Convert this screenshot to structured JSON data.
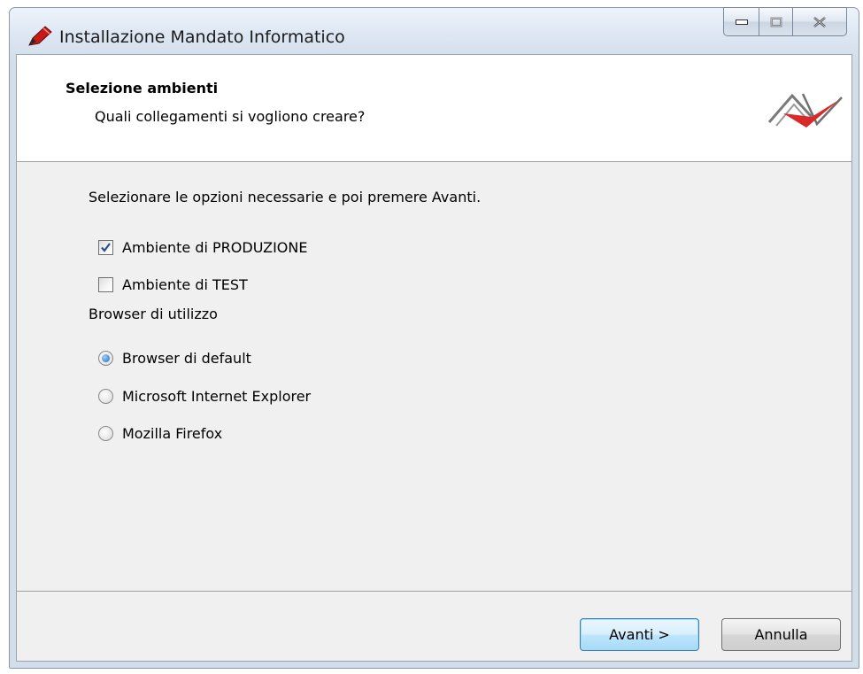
{
  "window": {
    "title": "Installazione Mandato Informatico",
    "controls": {
      "minimize_icon": "minimize-icon",
      "maximize_icon": "maximize-icon",
      "close_icon": "close-icon"
    }
  },
  "header": {
    "title": "Selezione ambienti",
    "subtitle": "Quali collegamenti si vogliono creare?",
    "logo_icon": "checkmark-logo",
    "logo_color": "#d92a2a"
  },
  "body": {
    "instruction": "Selezionare le opzioni necessarie e poi premere Avanti.",
    "environments": [
      {
        "label": "Ambiente di PRODUZIONE",
        "checked": true
      },
      {
        "label": "Ambiente di TEST",
        "checked": false
      }
    ],
    "browser_section_label": "Browser di utilizzo",
    "browsers": [
      {
        "label": "Browser di default",
        "selected": true
      },
      {
        "label": "Microsoft Internet Explorer",
        "selected": false
      },
      {
        "label": "Mozilla Firefox",
        "selected": false
      }
    ]
  },
  "footer": {
    "next_label": "Avanti >",
    "cancel_label": "Annulla",
    "accent_color": "#3c7fb1"
  }
}
